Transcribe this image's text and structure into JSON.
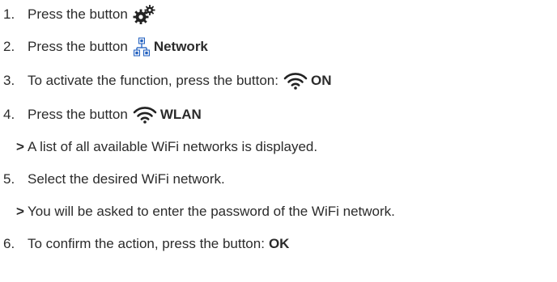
{
  "steps": [
    {
      "number": "1.",
      "text": "Press the button",
      "icon": "gears-icon",
      "bold": ""
    },
    {
      "number": "2.",
      "text": "Press the button",
      "icon": "network-icon",
      "bold": "Network"
    },
    {
      "number": "3.",
      "text": "To activate the function, press the button:",
      "icon": "wifi-icon",
      "bold": "ON"
    },
    {
      "number": "4.",
      "text": "Press the button",
      "icon": "wifi-icon",
      "bold": "WLAN"
    },
    {
      "number": "5.",
      "text": "Select the desired WiFi network."
    },
    {
      "number": "6.",
      "text": "To confirm the action, press the button:",
      "bold": "OK"
    }
  ],
  "results": [
    {
      "marker": ">",
      "text": "A list of all available WiFi networks is displayed."
    },
    {
      "marker": ">",
      "text": "You will be asked to enter the password of the WiFi network."
    }
  ],
  "colors": {
    "text": "#2b2b2b",
    "icon_dark": "#222222",
    "network_blue": "#1f5fbf"
  }
}
